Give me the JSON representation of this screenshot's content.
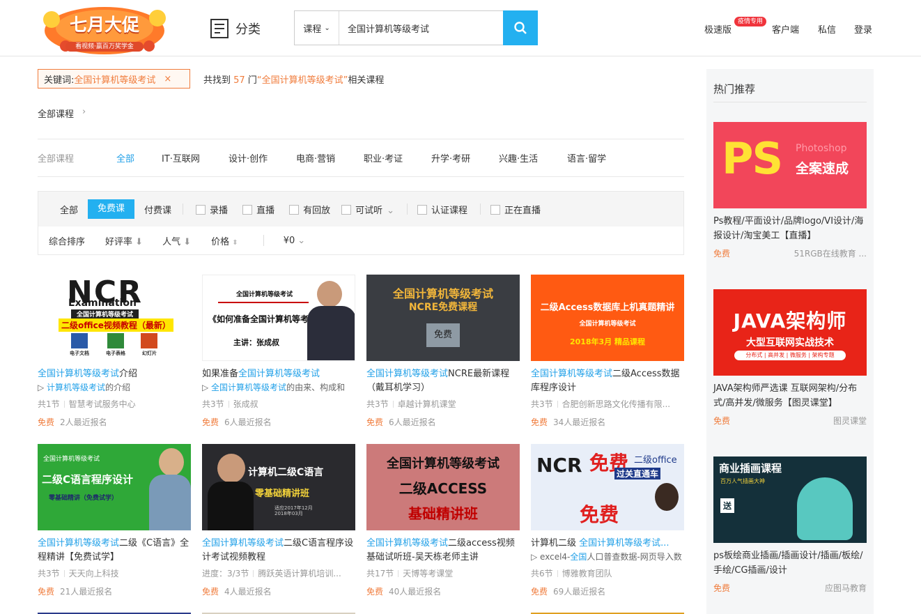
{
  "header": {
    "promo_title": "七月大促",
    "promo_sub": "看视频·赢百万奖学金",
    "category_label": "分类",
    "search_type": "课程",
    "search_value": "全国计算机等级考试",
    "links": {
      "lite": "极速版",
      "lite_badge": "疫情专用",
      "client": "客户端",
      "message": "私信",
      "login": "登录"
    }
  },
  "keyword": {
    "label": "关键词:",
    "value": "全国计算机等级考试",
    "close": "×"
  },
  "result": {
    "prefix": "共找到",
    "count": "57",
    "unit": "门",
    "quote": "“全国计算机等级考试”",
    "suffix": "相关课程"
  },
  "breadcrumb": {
    "label": "全部课程",
    "arrow": "›"
  },
  "category_tabs": {
    "head": "全部课程",
    "items": [
      "全部",
      "IT·互联网",
      "设计·创作",
      "电商·营销",
      "职业·考证",
      "升学·考研",
      "兴趣·生活",
      "语言·留学"
    ]
  },
  "filters": {
    "types": [
      "全部",
      "免费课",
      "付费课"
    ],
    "checks": [
      "录播",
      "直播",
      "有回放",
      "可试听",
      "认证课程",
      "正在直播"
    ],
    "sorts": [
      "综合排序",
      "好评率",
      "人气",
      "价格"
    ],
    "price": "¥0"
  },
  "courses": [
    {
      "hl": "全国计算机等级考试",
      "title": "介绍",
      "sub_hl": "计算机等级考试",
      "sub": "的介绍",
      "lessons": "共1节",
      "org": "智慧考试服务中心",
      "price": "免费",
      "enrolled": "2人最近报名",
      "thumb": {
        "t1": "NCR",
        "t2": "Examination",
        "t3": "全国计算机等级考试",
        "t4": "二级office视频教程（最新）",
        "t5": "电子文档",
        "t6": "电子表格",
        "t7": "幻灯片"
      }
    },
    {
      "pre": "如果准备",
      "hl": "全国计算机等级考试",
      "title": "",
      "sub_hl": "全国计算机等级考试",
      "sub": "的由来、构成和",
      "lessons": "共3节",
      "org": "张成叔",
      "price": "免费",
      "enrolled": "6人最近报名",
      "thumb": {
        "t1": "全国计算机等级考试",
        "t2": "《如何准备全国计算机等考》",
        "t3": "主讲：张成叔"
      }
    },
    {
      "hl": "全国计算机等级考试",
      "title": "NCRE最新课程（戴耳机学习）",
      "lessons": "共3节",
      "org": "卓越计算机课堂",
      "price": "免费",
      "enrolled": "6人最近报名",
      "thumb": {
        "t1": "全国计算机等级考试",
        "t2": "NCRE免费课程",
        "t3": "免费"
      }
    },
    {
      "hl": "全国计算机等级考试",
      "title": "二级Access数据库程序设计",
      "lessons": "共3节",
      "org": "合肥创新思路文化传播有限...",
      "price": "免费",
      "enrolled": "34人最近报名",
      "thumb": {
        "t1": "二级Access数据库上机真题精讲",
        "t2": "全国计算机等级考试",
        "t3": "2018年3月 精品课程"
      }
    },
    {
      "hl": "全国计算机等级考试",
      "title": "二级《C语言》全程精讲【免费试学】",
      "lessons": "共3节",
      "org": "天天向上科技",
      "price": "免费",
      "enrolled": "21人最近报名",
      "thumb": {
        "t1": "全国计算机等级考试",
        "t2": "二级C语言程序设计",
        "t3": "零基础精讲（免费试学）"
      }
    },
    {
      "hl": "全国计算机等级考试",
      "title": "二级C语言程序设计考试视频教程",
      "lessons": "进度：3/3节",
      "org": "腾跃英语计算机培训...",
      "price": "免费",
      "enrolled": "4人最近报名",
      "thumb": {
        "t1": "计算机二级C语言",
        "t2": "零基础精讲班",
        "t3": "适应2017年12月 2018年03月"
      }
    },
    {
      "hl": "全国计算机等级考试",
      "title": "二级access视频基础试听班-吴天栋老师主讲",
      "lessons": "共17节",
      "org": "天博等考课堂",
      "price": "免费",
      "enrolled": "40人最近报名",
      "thumb": {
        "t1": "全国计算机等级考试",
        "t2": "二级ACCESS",
        "t3": "基础精讲班"
      }
    },
    {
      "pre": "计算机二级 ",
      "hl": "全国计算机等级考试...",
      "title": "",
      "sub_pre": "excel4-",
      "sub_hl": "全国",
      "sub": "人口普查数据-网页导入数",
      "lessons": "共6节",
      "org": "博雅教育团队",
      "price": "免费",
      "enrolled": "69人最近报名",
      "thumb": {
        "t1": "免费",
        "t2": "二级office",
        "t3": "过关直通车",
        "t4": "免费",
        "t5": "NCR"
      }
    }
  ],
  "hot": {
    "title": "热门推荐",
    "items": [
      {
        "title": "Ps教程/平面设计/品牌logo/VI设计/海报设计/淘宝美工【直播】",
        "price": "免费",
        "org": "51RGB在线教育 ...",
        "img1": "PS",
        "img2": "全案速成",
        "img3": "Photoshop"
      },
      {
        "title": "JAVA架构师严选课 互联网架构/分布式/高并发/微服务【图灵课堂】",
        "price": "免费",
        "org": "图灵课堂",
        "img1": "JAVA架构师",
        "img2": "大型互联网实战技术",
        "img3": "分布式 | 高并发 | 微服务 | 架构专题"
      },
      {
        "title": "ps板绘商业插画/插画设计/插画/板绘/手绘/CG插画/设计",
        "price": "免费",
        "org": "应图马教育",
        "img1": "商业插画课程",
        "img2": "百万人气插画大神",
        "img3": "送"
      }
    ]
  },
  "colors": {
    "accent": "#23b0f0",
    "orange": "#f07c3c",
    "link": "#23a1e8"
  }
}
